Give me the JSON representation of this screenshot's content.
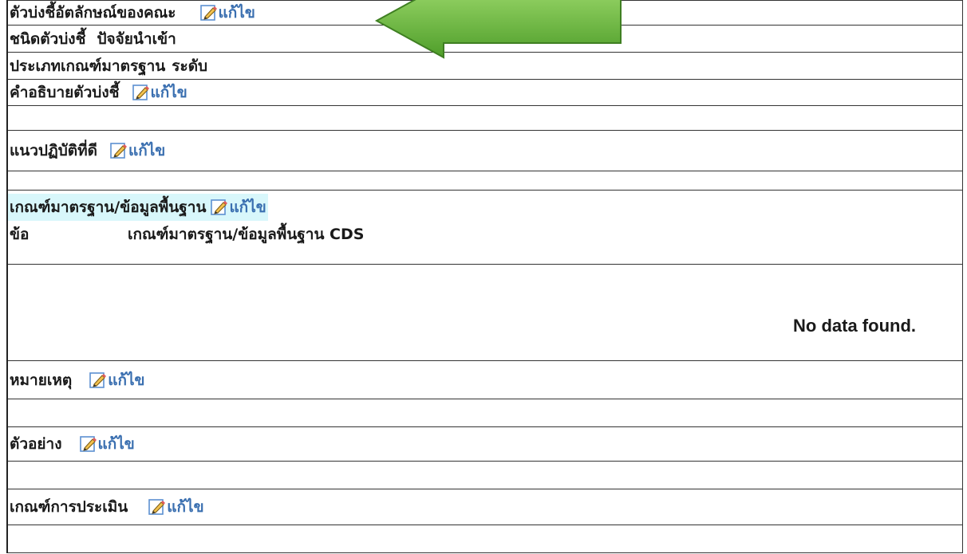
{
  "edit_label": "แก้ไข",
  "faculty_indicator": {
    "label": "ตัวบ่งชี้อัตลักษณ์ของคณะ"
  },
  "indicator_type": {
    "label": "ชนิดตัวบ่งชี้",
    "value": "ปัจจัยนำเข้า"
  },
  "criteria_type": {
    "label": "ประเภทเกณฑ์มาตรฐาน",
    "value": "ระดับ"
  },
  "description": {
    "label": "คำอธิบายตัวบ่งชี้"
  },
  "best_practice": {
    "label": "แนวปฏิบัติที่ดี"
  },
  "standard_criteria": {
    "label": "เกณฑ์มาตรฐาน/ข้อมูลพื้นฐาน",
    "col_no": "ข้อ",
    "col_name": "เกณฑ์มาตรฐาน/ข้อมูลพื้นฐาน CDS",
    "empty_text": "No data found."
  },
  "remark": {
    "label": "หมายเหตุ"
  },
  "example": {
    "label": "ตัวอย่าง"
  },
  "assessment": {
    "label": "เกณฑ์การประเมิน"
  },
  "colors": {
    "link": "#3a6fb0",
    "highlight": "#d8f7fb",
    "arrow": "#6fbf3a"
  },
  "icons": {
    "edit": "pencil-edit-icon",
    "callout": "green-arrow-left"
  }
}
